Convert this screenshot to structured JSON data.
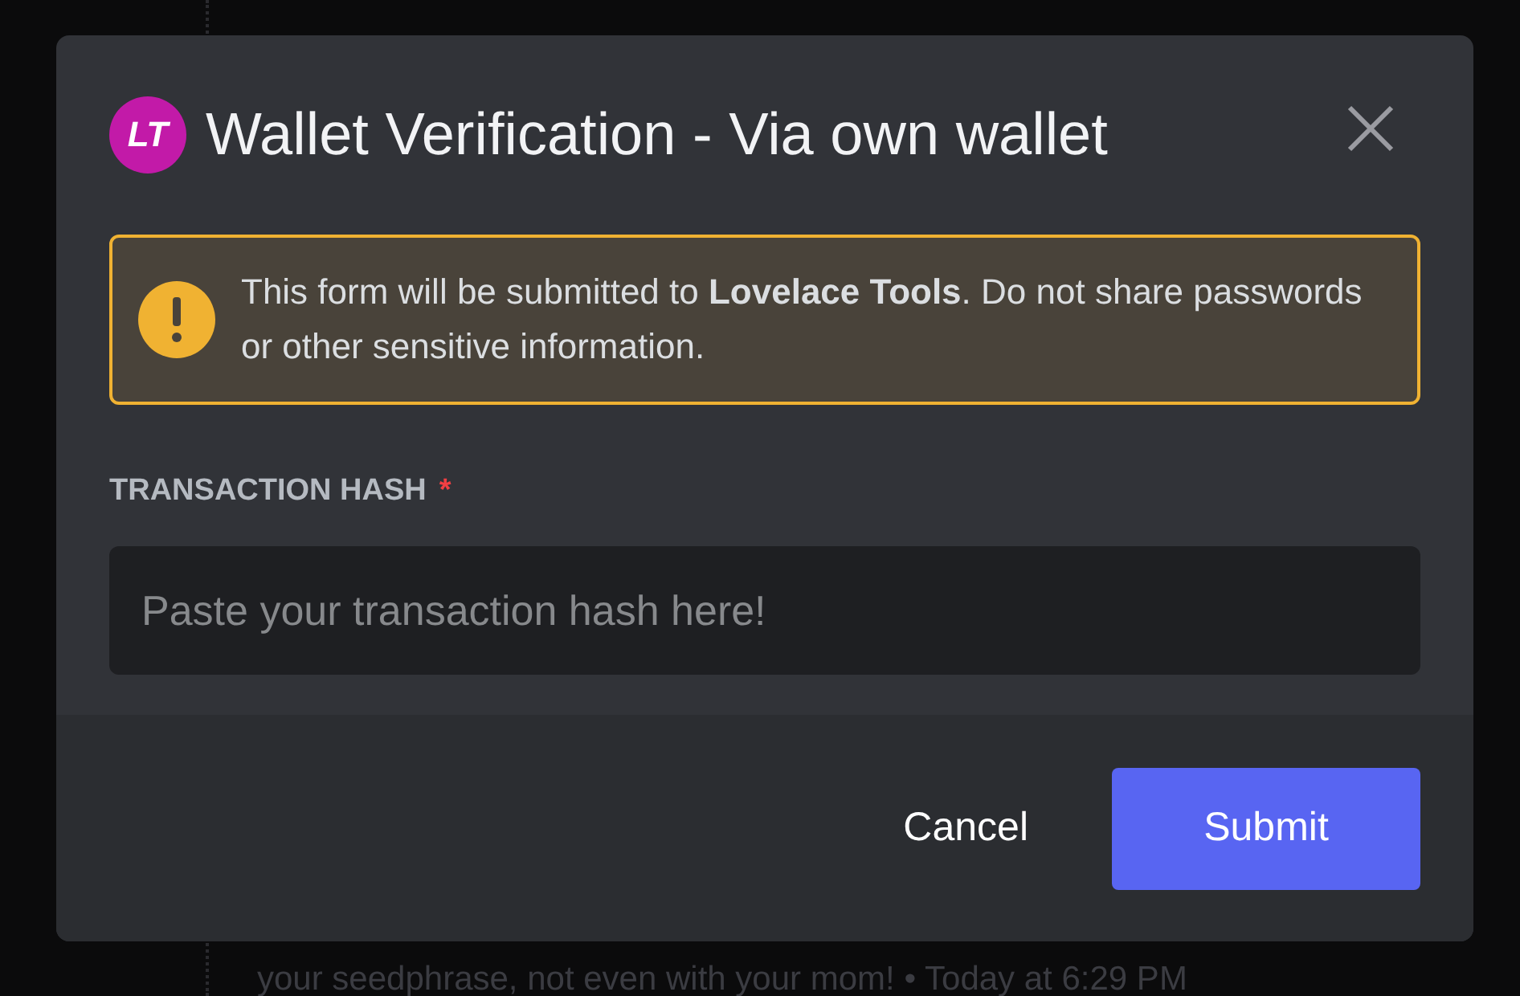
{
  "background_message": {
    "text": "your seedphrase, not even with your mom! • Today at 6:29 PM"
  },
  "modal": {
    "logo": "LT",
    "title": "Wallet Verification - Via own wallet",
    "notice": "This form will be submitted to **Lovelace Tools**. Do not share passwords or other sensitive information.",
    "field": {
      "label": "TRANSACTION HASH",
      "required_mark": "*",
      "placeholder": "Paste your transaction hash here!"
    },
    "buttons": [
      {
        "label": "Cancel",
        "kind": "secondary"
      },
      {
        "label": "Submit",
        "kind": "primary"
      }
    ]
  }
}
